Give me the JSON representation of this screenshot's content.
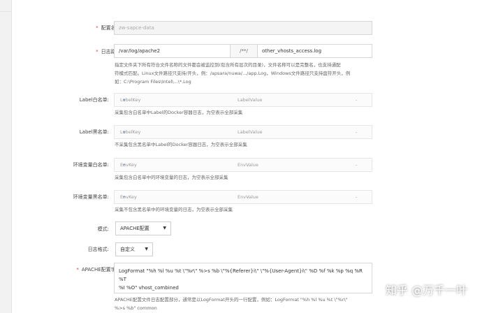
{
  "form": {
    "config_name": {
      "label": "配置名称:",
      "value": "zw-sapce-data"
    },
    "log_path": {
      "label": "日志路径:",
      "dir": "/var/log/apache2",
      "sep": "/**/",
      "file": "other_vhosts_access.log",
      "hint1": "指定文件夹下所有符合文件名称的文件都会被监控到(包含所有层次的目录)，文件名称可以是完整名，也支持通配",
      "hint2": "符模式匹配。Linux文件路径只支持/开头，例：/apsara/nuwa/.../app.Log，Windows文件路径只支持盘符开头，例",
      "hint3": "如：C:\\Program Files\\Intel\\...\\*.Log"
    },
    "label_white": {
      "label": "Label白名单:",
      "key": "LabelKey",
      "value": "LabelValue",
      "dash": "-",
      "hint": "采集包含白名单中Label的Docker容器日志，为空表示全部采集"
    },
    "label_black": {
      "label": "Label黑名单:",
      "key": "LabelKey",
      "value": "LabelValue",
      "dash": "-",
      "hint": "不采集包含黑名单中Label的Docker容器日志，为空表示全部采集"
    },
    "env_white": {
      "label": "环境变量白名单:",
      "key": "EnvKey",
      "value": "EnvValue",
      "dash": "-",
      "hint": "采集包含白名单中的环境变量的日志，为空表示全部采集"
    },
    "env_black": {
      "label": "环境变量黑名单:",
      "key": "EnvKey",
      "value": "EnvValue",
      "dash": "-",
      "hint": "采集不包含黑名单中的环境变量的日志，为空表示全部采集"
    },
    "mode": {
      "label": "模式:",
      "value": "APACHE配置"
    },
    "log_format": {
      "label": "日志格式:",
      "value": "自定义"
    },
    "apache_field": {
      "label": "APACHE配置字段:",
      "line1": "LogFormat \"%h %l %u %t \\\"%r\\\" %>s %b \\\"%{Referer}i\\\" \\\"%{User-Agent}i\\\" %D %f %k %p %q %R %T",
      "line2": "%I %O\" vhost_combined",
      "hint1": "APACHE配置文件日志配置部分，通常是以LogFormat开头的一行配置，例如：LogFormat \"%h %l %u %t \\\"%r\\\"",
      "hint2": "%>s %b\" common"
    },
    "required_mark": "*",
    "plus": "+"
  },
  "watermark": {
    "text": "知乎 @万千一叶"
  },
  "colors": {
    "required": "#e4393c",
    "link": "#4a7fd0",
    "bg": "#f2f2f2"
  }
}
